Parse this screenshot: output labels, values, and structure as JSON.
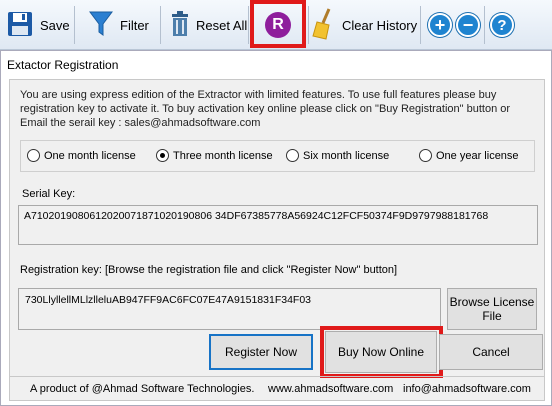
{
  "toolbar": {
    "save_label": "Save",
    "filter_label": "Filter",
    "reset_label": "Reset All",
    "r_letter": "R",
    "clear_history_label": "Clear History",
    "plus_symbol": "+",
    "minus_symbol": "−",
    "help_symbol": "?"
  },
  "window": {
    "title": "Extactor Registration"
  },
  "info": {
    "text_line1": "You are using express edition of the Extractor with limited features. To use full features please buy",
    "text_line2": "registration key to activate it. To buy activation key online please click on \"Buy Registration\" button  or",
    "text_line3": "Email the serail key :     sales@ahmadsoftware.com"
  },
  "license_options": [
    {
      "label": "One month license",
      "selected": false
    },
    {
      "label": "Three month license",
      "selected": true
    },
    {
      "label": "Six month license",
      "selected": false
    },
    {
      "label": "One year license",
      "selected": false
    }
  ],
  "serial": {
    "label": "Serial Key:",
    "value": "A7102019080612020071871020190806 34DF67385778A56924C12FCF50374F9D9797988181768"
  },
  "registration": {
    "label": "Registration key: [Browse the registration file and click \"Register Now\" button]",
    "value": "730LlyllellMLlzlleluAB947FF9AC6FC07E47A9151831F34F03"
  },
  "buttons": {
    "browse": "Browse License File",
    "register": "Register Now",
    "buy_now": "Buy Now Online",
    "cancel": "Cancel"
  },
  "footer": {
    "product": "A product of @Ahmad Software Technologies.",
    "website": "www.ahmadsoftware.com",
    "email": "info@ahmadsoftware.com"
  }
}
